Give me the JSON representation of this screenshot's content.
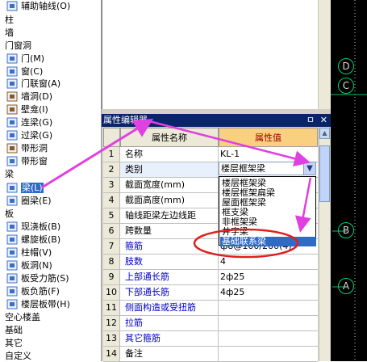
{
  "tree": {
    "items": [
      {
        "kind": "leaf",
        "label": "辅助轴线(O)",
        "icon": "grid-axis-icon"
      },
      {
        "kind": "cat",
        "label": "柱"
      },
      {
        "kind": "cat",
        "label": "墙"
      },
      {
        "kind": "cat",
        "label": "门窗洞"
      },
      {
        "kind": "leaf",
        "label": "门(M)",
        "icon": "door-icon"
      },
      {
        "kind": "leaf",
        "label": "窗(C)",
        "icon": "window-icon"
      },
      {
        "kind": "leaf",
        "label": "门联窗(A)",
        "icon": "door-window-icon"
      },
      {
        "kind": "leaf",
        "label": "墙洞(D)",
        "icon": "wall-hole-icon"
      },
      {
        "kind": "leaf",
        "label": "壁龛(I)",
        "icon": "niche-icon"
      },
      {
        "kind": "leaf",
        "label": "连梁(G)",
        "icon": "link-beam-icon"
      },
      {
        "kind": "leaf",
        "label": "过梁(G)",
        "icon": "lintel-icon"
      },
      {
        "kind": "leaf",
        "label": "带形洞",
        "icon": "strip-hole-icon"
      },
      {
        "kind": "leaf",
        "label": "带形窗",
        "icon": "strip-window-icon"
      },
      {
        "kind": "cat",
        "label": "梁"
      },
      {
        "kind": "leaf",
        "label": "梁(L)",
        "icon": "beam-icon",
        "selected": true
      },
      {
        "kind": "leaf",
        "label": "圈梁(E)",
        "icon": "ring-beam-icon"
      },
      {
        "kind": "cat",
        "label": "板"
      },
      {
        "kind": "leaf",
        "label": "现浇板(B)",
        "icon": "cast-slab-icon"
      },
      {
        "kind": "leaf",
        "label": "螺旋板(B)",
        "icon": "spiral-slab-icon"
      },
      {
        "kind": "leaf",
        "label": "柱帽(V)",
        "icon": "column-cap-icon"
      },
      {
        "kind": "leaf",
        "label": "板洞(N)",
        "icon": "slab-hole-icon"
      },
      {
        "kind": "leaf",
        "label": "板受力筋(S)",
        "icon": "slab-rebar-icon"
      },
      {
        "kind": "leaf",
        "label": "板负筋(F)",
        "icon": "negative-rebar-icon"
      },
      {
        "kind": "leaf",
        "label": "楼层板带(H)",
        "icon": "slab-strip-icon"
      },
      {
        "kind": "cat",
        "label": "空心楼盖"
      },
      {
        "kind": "cat",
        "label": "基础"
      },
      {
        "kind": "cat",
        "label": "其它"
      },
      {
        "kind": "cat",
        "label": "自定义"
      }
    ]
  },
  "editor": {
    "title": "属性编辑器",
    "pin": "ㅁ",
    "close": "✕",
    "col_name": "属性名称",
    "col_value": "属性值",
    "rows": [
      {
        "n": "1",
        "name": "名称",
        "value": "KL-1",
        "blue": false
      },
      {
        "n": "2",
        "name": "类别",
        "value": "楼层框架梁",
        "blue": false
      },
      {
        "n": "3",
        "name": "截面宽度(mm)",
        "value": "",
        "blue": false
      },
      {
        "n": "4",
        "name": "截面高度(mm)",
        "value": "",
        "blue": false
      },
      {
        "n": "5",
        "name": "轴线距梁左边线距",
        "value": "",
        "blue": false
      },
      {
        "n": "6",
        "name": "跨数量",
        "value": "",
        "blue": false
      },
      {
        "n": "7",
        "name": "箍筋",
        "value": "ф8@100/200(4)",
        "blue": true
      },
      {
        "n": "8",
        "name": "肢数",
        "value": "4",
        "blue": true
      },
      {
        "n": "9",
        "name": "上部通长筋",
        "value": "2ф25",
        "blue": true
      },
      {
        "n": "10",
        "name": "下部通长筋",
        "value": "4ф25",
        "blue": true
      },
      {
        "n": "11",
        "name": "侧面构造或受扭筋",
        "value": "",
        "blue": true
      },
      {
        "n": "12",
        "name": "拉筋",
        "value": "",
        "blue": true
      },
      {
        "n": "13",
        "name": "其它箍筋",
        "value": "",
        "blue": true
      },
      {
        "n": "14",
        "name": "备注",
        "value": "",
        "blue": false
      }
    ]
  },
  "dropdown": {
    "current": "楼层框架梁",
    "options": [
      "楼层框架梁",
      "楼层框架扁梁",
      "屋面框架梁",
      "框支梁",
      "非框架梁",
      "井字梁",
      "基础联系梁"
    ],
    "highlighted_index": 6
  },
  "cad": {
    "axis_labels": [
      "D",
      "C",
      "B",
      "A"
    ]
  },
  "colors": {
    "annotation": "#e040e0",
    "highlight_ellipse": "#e02020",
    "selection": "#316ac5",
    "title_bar": "#0a246a"
  }
}
